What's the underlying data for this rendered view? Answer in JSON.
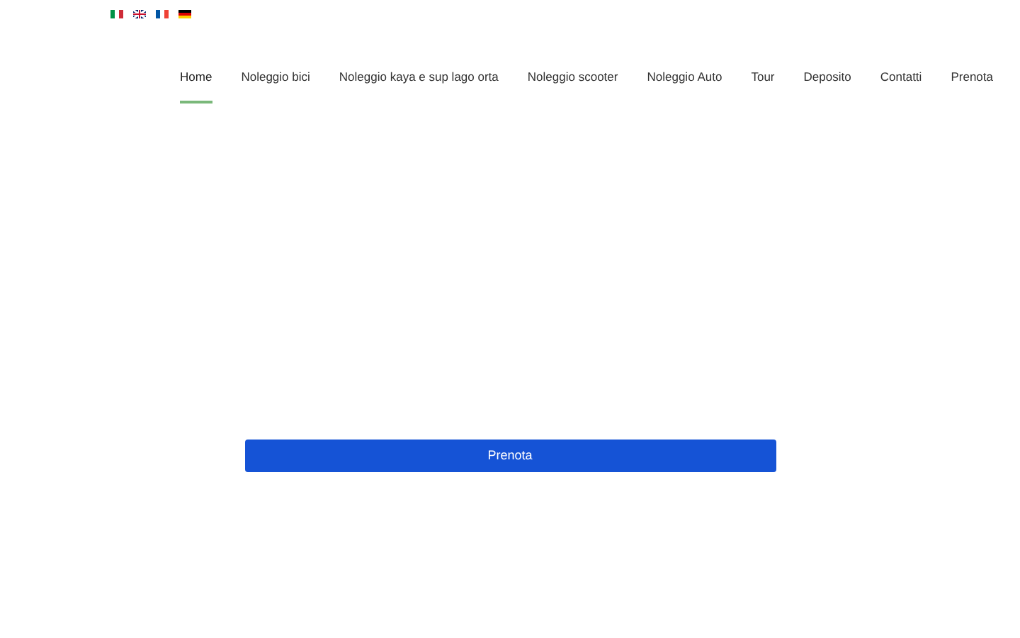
{
  "language_flags": [
    {
      "kind": "italy"
    },
    {
      "kind": "uk"
    },
    {
      "kind": "france"
    },
    {
      "kind": "germany"
    }
  ],
  "nav": [
    {
      "label": "Home",
      "selected": true
    },
    {
      "label": "Noleggio bici",
      "selected": false
    },
    {
      "label": "Noleggio kaya e sup lago orta",
      "selected": false
    },
    {
      "label": "Noleggio scooter",
      "selected": false
    },
    {
      "label": "Noleggio Auto",
      "selected": false
    },
    {
      "label": "Tour",
      "selected": false
    },
    {
      "label": "Deposito",
      "selected": false
    },
    {
      "label": "Contatti",
      "selected": false
    },
    {
      "label": "Prenota",
      "selected": false
    }
  ],
  "book_button": {
    "label": "Prenota"
  }
}
